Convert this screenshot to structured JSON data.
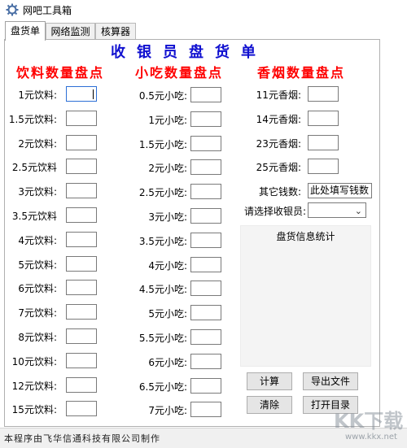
{
  "window": {
    "title": "网吧工具箱"
  },
  "tabs": [
    {
      "label": "盘货单"
    },
    {
      "label": "网络监测"
    },
    {
      "label": "核算器"
    }
  ],
  "heading": "收银员盘货单",
  "sections": {
    "drinks": "饮料数量盘点",
    "snacks": "小吃数量盘点",
    "cigarettes": "香烟数量盘点"
  },
  "drinks": [
    {
      "label": "1元饮料:",
      "value": ""
    },
    {
      "label": "1.5元饮料:",
      "value": ""
    },
    {
      "label": "2元饮料:",
      "value": ""
    },
    {
      "label": "2.5元饮料",
      "value": ""
    },
    {
      "label": "3元饮料:",
      "value": ""
    },
    {
      "label": "3.5元饮料",
      "value": ""
    },
    {
      "label": "4元饮料:",
      "value": ""
    },
    {
      "label": "5元饮料:",
      "value": ""
    },
    {
      "label": "6元饮料:",
      "value": ""
    },
    {
      "label": "7元饮料:",
      "value": ""
    },
    {
      "label": "8元饮料:",
      "value": ""
    },
    {
      "label": "10元饮料:",
      "value": ""
    },
    {
      "label": "12元饮料:",
      "value": ""
    },
    {
      "label": "15元饮料:",
      "value": ""
    }
  ],
  "snacks": [
    {
      "label": "0.5元小吃:",
      "value": ""
    },
    {
      "label": "1元小吃:",
      "value": ""
    },
    {
      "label": "1.5元小吃:",
      "value": ""
    },
    {
      "label": "2元小吃:",
      "value": ""
    },
    {
      "label": "2.5元小吃:",
      "value": ""
    },
    {
      "label": "3元小吃:",
      "value": ""
    },
    {
      "label": "3.5元小吃:",
      "value": ""
    },
    {
      "label": "4元小吃:",
      "value": ""
    },
    {
      "label": "4.5元小吃:",
      "value": ""
    },
    {
      "label": "5元小吃:",
      "value": ""
    },
    {
      "label": "5.5元小吃:",
      "value": ""
    },
    {
      "label": "6元小吃:",
      "value": ""
    },
    {
      "label": "6.5元小吃:",
      "value": ""
    },
    {
      "label": "7元小吃:",
      "value": ""
    }
  ],
  "cigarettes": [
    {
      "label": "11元香烟:",
      "value": ""
    },
    {
      "label": "14元香烟:",
      "value": ""
    },
    {
      "label": "23元香烟:",
      "value": ""
    },
    {
      "label": "25元香烟:",
      "value": ""
    }
  ],
  "other_money": {
    "label": "其它钱数:",
    "value": "此处填写钱数"
  },
  "cashier": {
    "label": "请选择收银员:",
    "selected": ""
  },
  "stats": {
    "title": "盘货信息统计"
  },
  "buttons": {
    "calculate": "计算",
    "export": "导出文件",
    "clear": "清除",
    "open_dir": "打开目录"
  },
  "status": {
    "text": "本程序由飞华信通科技有限公司制作"
  },
  "watermark": {
    "text": "KK下载",
    "url": "www.kkx.net"
  }
}
